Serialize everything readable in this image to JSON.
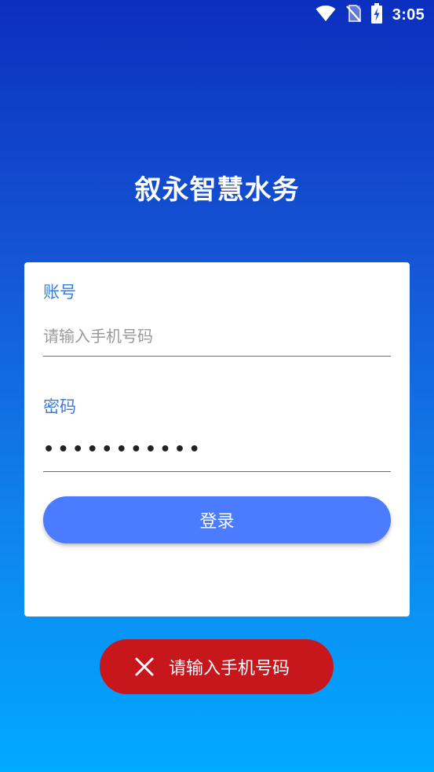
{
  "status_bar": {
    "time": "3:05",
    "icons": [
      "wifi-icon",
      "no-sim-icon",
      "battery-charging-icon"
    ]
  },
  "app": {
    "title": "叙永智慧水务"
  },
  "login_form": {
    "account_label": "账号",
    "account_placeholder": "请输入手机号码",
    "account_value": "",
    "password_label": "密码",
    "password_masked": "•••••••••••",
    "login_button": "登录"
  },
  "toast": {
    "icon": "close-icon",
    "message": "请输入手机号码",
    "color": "#c8161d"
  },
  "colors": {
    "accent": "#4b7cff",
    "label": "#3b7bd9",
    "background_top": "#0b2fbf",
    "background_bottom": "#00aaff"
  }
}
